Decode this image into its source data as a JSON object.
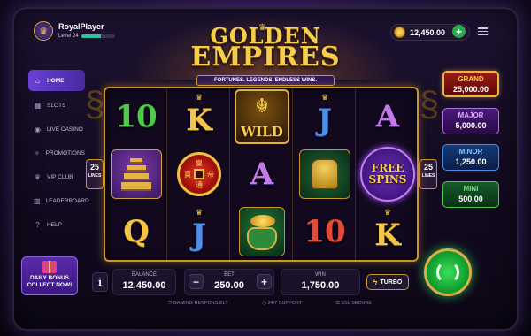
{
  "player": {
    "name": "RoyalPlayer",
    "level_label": "Level 24",
    "level_progress": 0.6
  },
  "wallet": {
    "coins": "12,450.00",
    "add_label": "+"
  },
  "logo": {
    "line1": "GOLDEN",
    "line2": "EMPIRES",
    "tagline": "FORTUNES. LEGENDS. ENDLESS WINS."
  },
  "sidebar": {
    "items": [
      {
        "label": "HOME",
        "icon": "home-icon",
        "glyph": "⌂"
      },
      {
        "label": "SLOTS",
        "icon": "slots-icon",
        "glyph": "▦"
      },
      {
        "label": "LIVE CASINO",
        "icon": "live-casino-icon",
        "glyph": "◉"
      },
      {
        "label": "PROMOTIONS",
        "icon": "promotions-icon",
        "glyph": "✧"
      },
      {
        "label": "VIP CLUB",
        "icon": "vip-icon",
        "glyph": "♛"
      },
      {
        "label": "LEADERBOARD",
        "icon": "leaderboard-icon",
        "glyph": "▥"
      },
      {
        "label": "HELP",
        "icon": "help-icon",
        "glyph": "?"
      }
    ]
  },
  "daily_bonus": {
    "line1": "DAILY BONUS",
    "line2": "COLLECT NOW!"
  },
  "reels": {
    "col1": {
      "top": "10",
      "bottom": "Q"
    },
    "col2": {
      "top": "K",
      "bottom": "J",
      "coin_chars": [
        "皇",
        "帝",
        "通",
        "寶"
      ]
    },
    "col3": {
      "wild": "WILD",
      "mid": "A"
    },
    "col4": {
      "top": "J",
      "bottom": "10"
    },
    "col5": {
      "top": "A",
      "fs1": "FREE",
      "fs2": "SPINS",
      "bottom": "K"
    }
  },
  "lines": {
    "count": "25",
    "label": "LINES"
  },
  "jackpots": {
    "grand": {
      "name": "GRAND",
      "value": "25,000.00"
    },
    "major": {
      "name": "MAJOR",
      "value": "5,000.00"
    },
    "minor": {
      "name": "MINOR",
      "value": "1,250.00"
    },
    "mini": {
      "name": "MINI",
      "value": "500.00"
    }
  },
  "bottom": {
    "info": "i",
    "balance_label": "BALANCE",
    "balance": "12,450.00",
    "bet_label": "BET",
    "bet": "250.00",
    "minus": "−",
    "plus": "+",
    "win_label": "WIN",
    "win": "1,750.00",
    "turbo": "TURBO"
  },
  "footer": {
    "a": "GAMING RESPONSIBLY",
    "b": "24/7 SUPPORT",
    "c": "SSL SECURE"
  },
  "colors": {
    "accent": "#6a3fd6",
    "gold": "#f3c84a",
    "spin": "#16a834"
  }
}
